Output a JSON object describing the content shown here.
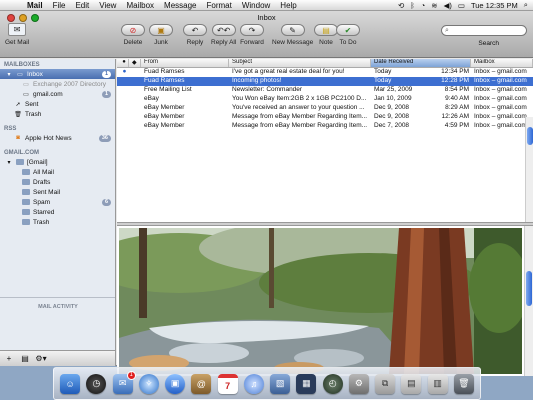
{
  "menubar": {
    "app": "Mail",
    "menus": [
      "File",
      "Edit",
      "View",
      "Mailbox",
      "Message",
      "Format",
      "Window",
      "Help"
    ],
    "clock": "Tue 12:35 PM"
  },
  "window": {
    "title": "Inbox",
    "get_mail": "Get Mail",
    "toolbar": {
      "delete": "Delete",
      "junk": "Junk",
      "reply": "Reply",
      "reply_all": "Reply All",
      "forward": "Forward",
      "new_message": "New Message",
      "note": "Note",
      "to_do": "To Do",
      "search_label": "Search"
    }
  },
  "sidebar": {
    "mailboxes_header": "MAILBOXES",
    "inbox": {
      "label": "Inbox",
      "count": "1"
    },
    "exchange": "Exchange 2007 Directory",
    "gmail": {
      "label": "gmail.com",
      "count": "1"
    },
    "sent": "Sent",
    "trash": "Trash",
    "rss_header": "RSS",
    "rss_item": {
      "label": "Apple Hot News",
      "count": "36"
    },
    "gmail_header": "GMAIL.COM",
    "gmail_folder": "[Gmail]",
    "gmail_items": [
      {
        "label": "All Mail",
        "count": ""
      },
      {
        "label": "Drafts",
        "count": ""
      },
      {
        "label": "Sent Mail",
        "count": ""
      },
      {
        "label": "Spam",
        "count": "6"
      },
      {
        "label": "Starred",
        "count": ""
      },
      {
        "label": "Trash",
        "count": ""
      }
    ],
    "mail_activity": "MAIL ACTIVITY"
  },
  "list": {
    "headers": {
      "from": "From",
      "subject": "Subject",
      "date": "Date Received",
      "mailbox": "Mailbox"
    },
    "rows": [
      {
        "from": "Fuad Ramses",
        "subject": "I've got a great real estate deal for you!",
        "date": "Today",
        "time": "12:34 PM",
        "mailbox": "Inbox – gmail.com"
      },
      {
        "from": "Fuad Ramses",
        "subject": "Incoming photos!",
        "date": "Today",
        "time": "12:28 PM",
        "mailbox": "Inbox – gmail.com"
      },
      {
        "from": "Free Mailing List",
        "subject": "Newsletter: Commander",
        "date": "Mar 25, 2009",
        "time": "8:54 PM",
        "mailbox": "Inbox – gmail.com"
      },
      {
        "from": "eBay",
        "subject": "You Won eBay Item:2GB 2 x 1GB PC2100 D...",
        "date": "Jan 10, 2009",
        "time": "9:40 AM",
        "mailbox": "Inbox – gmail.com"
      },
      {
        "from": "eBay Member",
        "subject": "You've received an answer to your question ...",
        "date": "Dec 9, 2008",
        "time": "8:29 AM",
        "mailbox": "Inbox – gmail.com"
      },
      {
        "from": "eBay Member",
        "subject": "Message from eBay Member Regarding Item...",
        "date": "Dec 9, 2008",
        "time": "12:26 AM",
        "mailbox": "Inbox – gmail.com"
      },
      {
        "from": "eBay Member",
        "subject": "Message from eBay Member Regarding Item...",
        "date": "Dec 7, 2008",
        "time": "4:59 PM",
        "mailbox": "Inbox – gmail.com"
      }
    ]
  },
  "dock": {
    "mail_badge": "1",
    "calendar_day": "7",
    "icons": [
      "finder-icon",
      "dashboard-icon",
      "mail-icon",
      "safari-icon",
      "ichat-icon",
      "address-book-icon",
      "ical-icon",
      "itunes-icon",
      "iphoto-icon",
      "spaces-icon",
      "time-machine-icon",
      "system-preferences-icon",
      "preview-icon",
      "documents-stack-icon",
      "downloads-stack-icon",
      "trash-icon"
    ]
  }
}
